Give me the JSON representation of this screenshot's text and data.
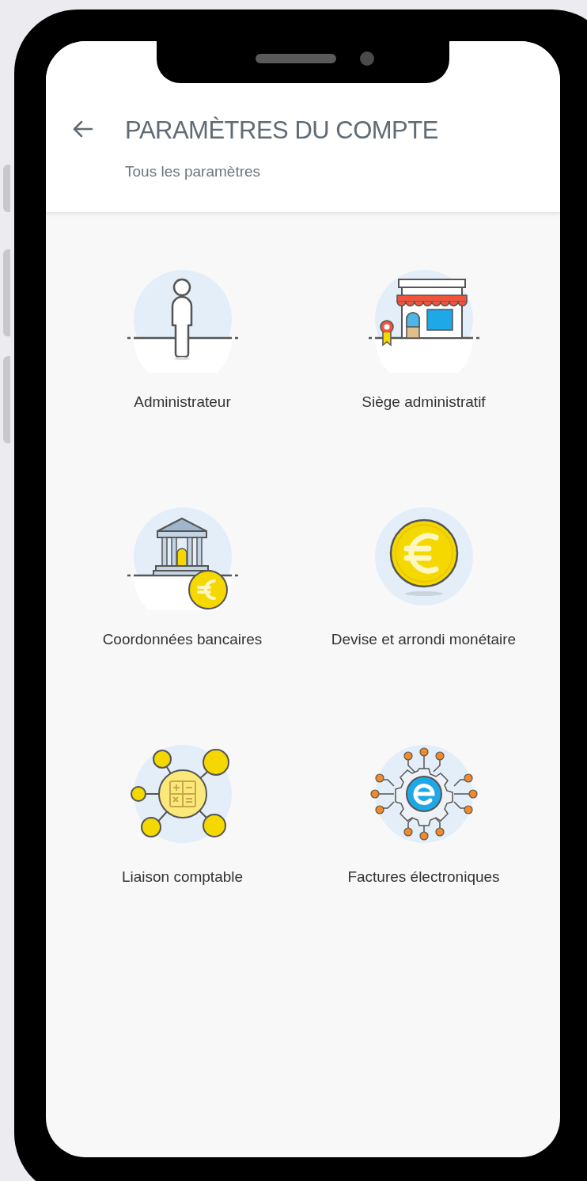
{
  "header": {
    "title": "PARAMÈTRES DU COMPTE",
    "subtitle": "Tous les paramètres"
  },
  "settings": [
    {
      "kind": "person",
      "label": "Administrateur"
    },
    {
      "kind": "shop",
      "label": "Siège administratif"
    },
    {
      "kind": "bank",
      "label": "Coordonnées bancaires"
    },
    {
      "kind": "coin",
      "label": "Devise et arrondi monétaire"
    },
    {
      "kind": "network",
      "label": "Liaison comptable"
    },
    {
      "kind": "chip",
      "label": "Factures électroniques"
    }
  ]
}
